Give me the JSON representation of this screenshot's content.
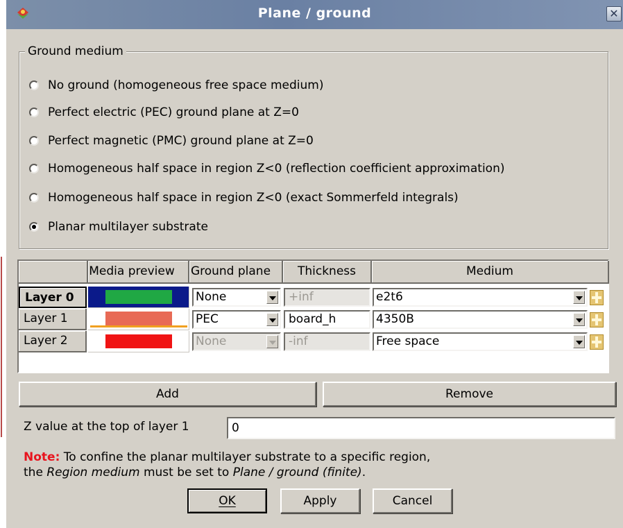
{
  "window": {
    "title": "Plane / ground",
    "close_glyph": "✕"
  },
  "ground_medium": {
    "group_title": "Ground medium",
    "options": [
      {
        "label": "No ground (homogeneous free space medium)",
        "checked": false
      },
      {
        "label": "Perfect electric (PEC) ground plane at Z=0",
        "checked": false
      },
      {
        "label": "Perfect magnetic (PMC) ground plane at Z=0",
        "checked": false
      },
      {
        "label": "Homogeneous half space in region Z<0 (reflection coefficient approximation)",
        "checked": false
      },
      {
        "label": "Homogeneous half space in region Z<0 (exact Sommerfeld integrals)",
        "checked": false
      },
      {
        "label": "Planar multilayer substrate",
        "checked": true
      }
    ]
  },
  "table": {
    "headers": [
      "Media preview",
      "Ground plane",
      "Thickness",
      "Medium"
    ],
    "rows": [
      {
        "name": "Layer 0",
        "preview_color": "#20a844",
        "preview_bg": "#0b1a8a",
        "ground_plane": "None",
        "thickness": "+inf",
        "medium": "e2t6"
      },
      {
        "name": "Layer 1",
        "preview_color": "#e86a56",
        "preview_bg": "#ffffff",
        "ground_plane": "PEC",
        "thickness": "board_h",
        "medium": "4350B"
      },
      {
        "name": "Layer 2",
        "preview_color": "#f01414",
        "preview_bg": "#ffffff",
        "ground_plane": "None",
        "thickness": "-inf",
        "medium": "Free space"
      }
    ]
  },
  "buttons": {
    "add": "Add",
    "remove": "Remove",
    "ok": "OK",
    "apply": "Apply",
    "cancel": "Cancel"
  },
  "z_value": {
    "label": "Z value at the top of layer 1",
    "value": "0"
  },
  "note": {
    "prefix": "Note:",
    "text1": " To confine the planar multilayer substrate to a specific region,",
    "text2a": "the ",
    "text2b": "Region medium",
    "text2c": " must be set to ",
    "text2d": "Plane / ground (finite)",
    "text2e": "."
  },
  "colors": {
    "titlebar": "#6a80a3",
    "dialog_bg": "#d4d0c8",
    "note_red": "#e8141e",
    "plus_gold": "#e5c572"
  },
  "icons": [
    "app-icon",
    "close-icon",
    "dropdown-arrow-icon",
    "add-medium-icon"
  ]
}
